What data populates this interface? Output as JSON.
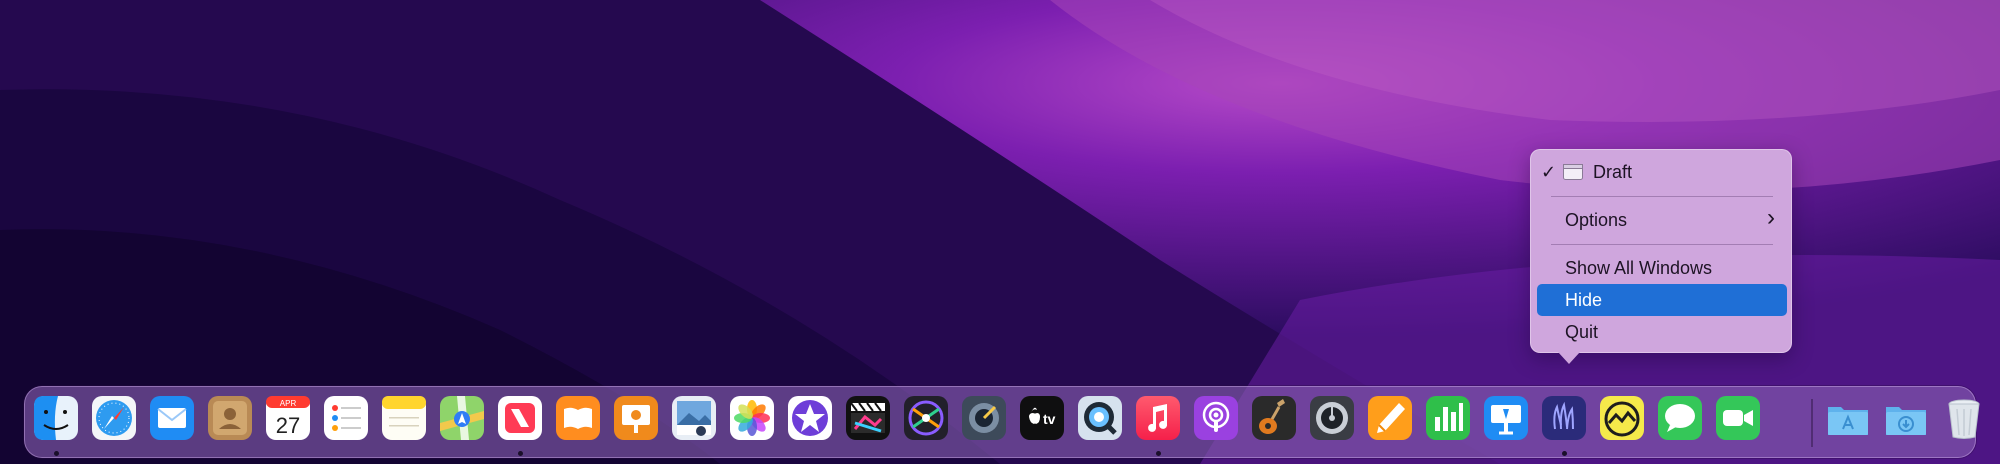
{
  "menu": {
    "items": [
      {
        "label": "Draft",
        "checked": true,
        "icon": "window-icon"
      },
      {
        "label": "Options",
        "submenu": true
      },
      {
        "label": "Show All Windows"
      },
      {
        "label": "Hide",
        "highlighted": true
      },
      {
        "label": "Quit"
      }
    ],
    "checkmark": "✓",
    "chevron": "›",
    "highlight_color": "#1f6fd6"
  },
  "dock": {
    "calendar": {
      "month": "APR",
      "day": "27"
    },
    "tv_label": "tv",
    "apps": [
      {
        "name": "Finder",
        "running": true
      },
      {
        "name": "Safari"
      },
      {
        "name": "Mail"
      },
      {
        "name": "Contacts"
      },
      {
        "name": "Calendar"
      },
      {
        "name": "Reminders"
      },
      {
        "name": "Notes"
      },
      {
        "name": "Maps"
      },
      {
        "name": "News",
        "running": true
      },
      {
        "name": "Books"
      },
      {
        "name": "Keynote Remote"
      },
      {
        "name": "Preview"
      },
      {
        "name": "Photos"
      },
      {
        "name": "iMovie"
      },
      {
        "name": "Final Cut Pro"
      },
      {
        "name": "Motion"
      },
      {
        "name": "Compressor"
      },
      {
        "name": "Apple TV"
      },
      {
        "name": "QuickTime Player"
      },
      {
        "name": "Music",
        "running": true
      },
      {
        "name": "Podcasts"
      },
      {
        "name": "GarageBand"
      },
      {
        "name": "Logic Pro"
      },
      {
        "name": "Pages"
      },
      {
        "name": "Numbers"
      },
      {
        "name": "Keynote"
      },
      {
        "name": "Draft App",
        "running": true
      },
      {
        "name": "Basecamp"
      },
      {
        "name": "Messages"
      },
      {
        "name": "FaceTime"
      },
      {
        "name": "Applications Folder"
      },
      {
        "name": "Downloads Folder"
      },
      {
        "name": "Trash"
      }
    ]
  }
}
